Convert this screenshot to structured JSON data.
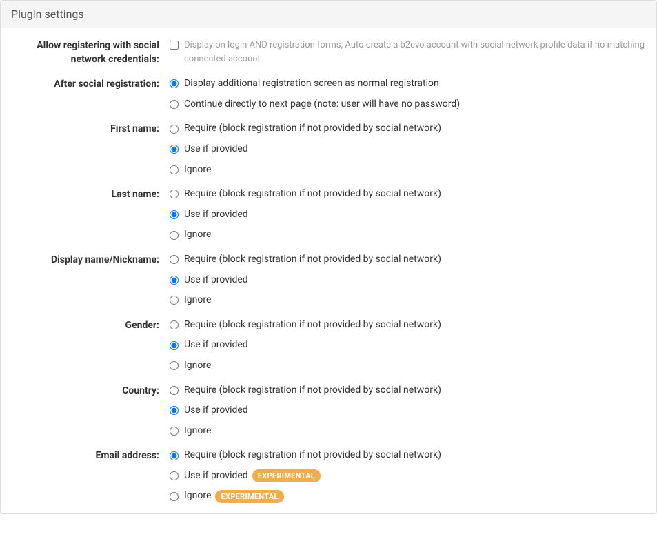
{
  "panel": {
    "title": "Plugin settings"
  },
  "badges": {
    "experimental": "EXPERIMENTAL"
  },
  "fields": {
    "allowRegister": {
      "label": "Allow registering with social network credentials:",
      "desc": "Display on login AND registration forms; Auto create a b2evo account with social network profile data if no matching connected account",
      "checked": false
    },
    "afterSocial": {
      "label": "After social registration:",
      "opts": {
        "additional": "Display additional registration screen as normal registration",
        "continue": "Continue directly to next page (note: user will have no password)"
      },
      "selected": "additional"
    },
    "firstName": {
      "label": "First name:",
      "opts": {
        "require": "Require (block registration if not provided by social network)",
        "provided": "Use if provided",
        "ignore": "Ignore"
      },
      "selected": "provided"
    },
    "lastName": {
      "label": "Last name:",
      "opts": {
        "require": "Require (block registration if not provided by social network)",
        "provided": "Use if provided",
        "ignore": "Ignore"
      },
      "selected": "provided"
    },
    "displayName": {
      "label": "Display name/Nickname:",
      "opts": {
        "require": "Require (block registration if not provided by social network)",
        "provided": "Use if provided",
        "ignore": "Ignore"
      },
      "selected": "provided"
    },
    "gender": {
      "label": "Gender:",
      "opts": {
        "require": "Require (block registration if not provided by social network)",
        "provided": "Use if provided",
        "ignore": "Ignore"
      },
      "selected": "provided"
    },
    "country": {
      "label": "Country:",
      "opts": {
        "require": "Require (block registration if not provided by social network)",
        "provided": "Use if provided",
        "ignore": "Ignore"
      },
      "selected": "provided"
    },
    "email": {
      "label": "Email address:",
      "opts": {
        "require": "Require (block registration if not provided by social network)",
        "provided": "Use if provided",
        "ignore": "Ignore"
      },
      "selected": "require"
    }
  }
}
